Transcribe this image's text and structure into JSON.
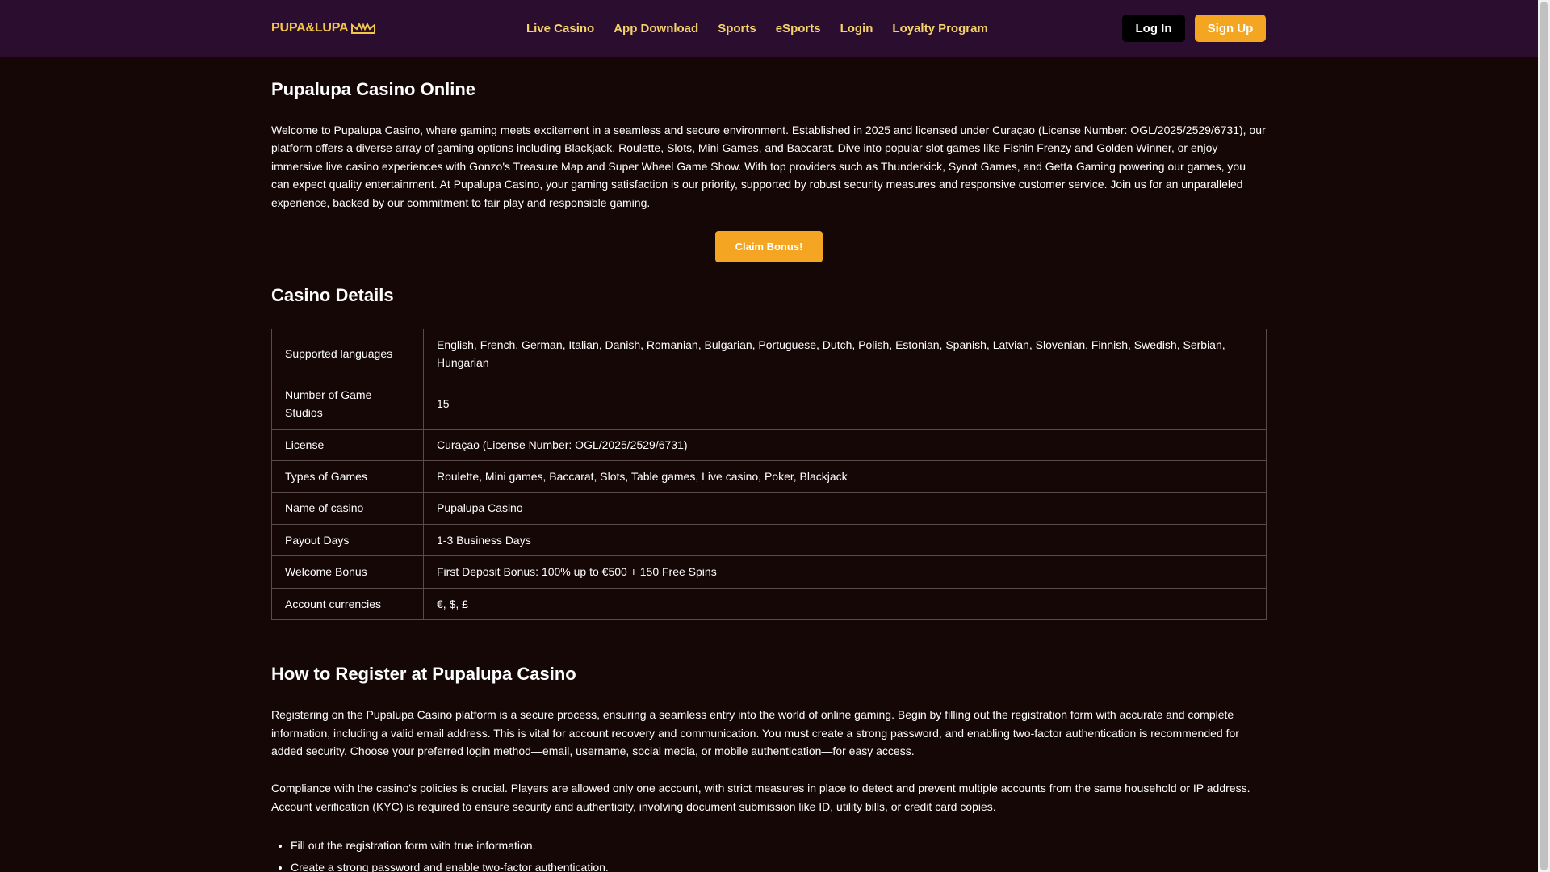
{
  "header": {
    "logo_text": "PUPA&LUPA",
    "nav": [
      "Live Casino",
      "App Download",
      "Sports",
      "eSports",
      "Login",
      "Loyalty Program"
    ],
    "login_label": "Log In",
    "signup_label": "Sign Up"
  },
  "main": {
    "title": "Pupalupa Casino Online",
    "intro": "Welcome to Pupalupa Casino, where gaming meets excitement in a seamless and secure environment. Established in 2025 and licensed under Curaçao (License Number: OGL/2025/2529/6731), our platform offers a diverse array of gaming options including Blackjack, Roulette, Slots, Mini Games, and Baccarat. Dive into popular slot games like Fishin Frenzy and Golden Winner, or enjoy immersive live casino experiences with Gonzo's Treasure Map and Super Wheel Game Show. With top providers such as Thunderkick, Synot Games, and Getta Gaming powering our games, you can expect quality entertainment. At Pupalupa Casino, your gaming satisfaction is our priority, supported by robust security measures and responsive customer service. Join us for an unparalleled experience, backed by our commitment to fair play and responsible gaming.",
    "cta_label": "Claim Bonus!",
    "details_title": "Casino Details",
    "details": [
      {
        "key": "Supported languages",
        "value": "English, French, German, Italian, Danish, Romanian, Bulgarian, Portuguese, Dutch, Polish, Estonian, Spanish, Latvian, Slovenian, Finnish, Swedish, Serbian, Hungarian"
      },
      {
        "key": "Number of Game Studios",
        "value": "15"
      },
      {
        "key": "License",
        "value": "Curaçao (License Number: OGL/2025/2529/6731)"
      },
      {
        "key": "Types of Games",
        "value": "Roulette, Mini games, Baccarat, Slots, Table games, Live casino, Poker, Blackjack"
      },
      {
        "key": "Name of casino",
        "value": "Pupalupa Casino"
      },
      {
        "key": "Payout Days",
        "value": "1-3 Business Days"
      },
      {
        "key": "Welcome Bonus",
        "value": "First Deposit Bonus: 100% up to €500 + 150 Free Spins"
      },
      {
        "key": "Account currencies",
        "value": "€, $, £"
      }
    ],
    "register_title": "How to Register at Pupalupa Casino",
    "register_p1": "Registering on the Pupalupa Casino platform is a secure process, ensuring a seamless entry into the world of online gaming. Begin by filling out the registration form with accurate and complete information, including a valid email address. This is vital for account recovery and communication. You must create a strong password, and enabling two-factor authentication is recommended for added security. Choose your preferred login method—email, username, social media, or mobile authentication—for easy access.",
    "register_p2": "Compliance with the casino's policies is crucial. Players are allowed only one account, with strict measures in place to detect and prevent multiple accounts from the same household or IP address. Account verification (KYC) is required to ensure security and authenticity, involving document submission like ID, utility bills, or credit card copies.",
    "register_steps": [
      "Fill out the registration form with true information.",
      "Create a strong password and enable two-factor authentication."
    ]
  },
  "colors": {
    "page_bg": "#160707",
    "header_bg": "#2b0e2f",
    "nav_text": "#f5d36b",
    "accent": "#f4a521",
    "logo": "#f2c64a"
  }
}
